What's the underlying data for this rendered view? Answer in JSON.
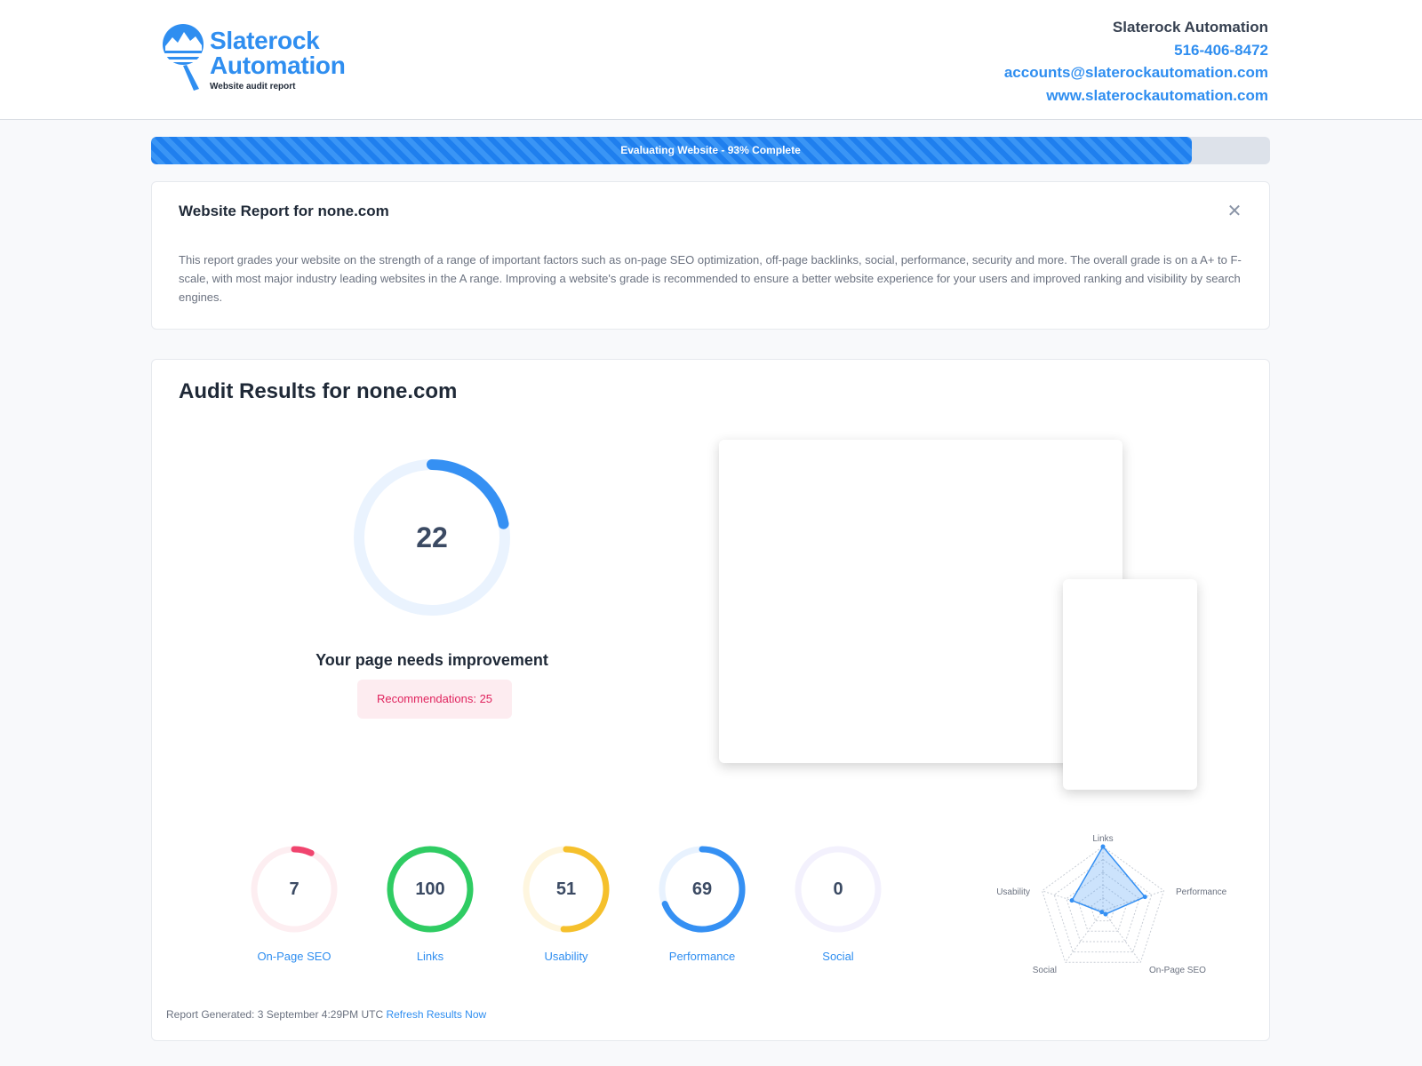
{
  "header": {
    "logo": {
      "line1": "Slaterock",
      "line2": "Automation",
      "tagline": "Website audit report"
    },
    "company": "Slaterock Automation",
    "phone": "516-406-8472",
    "email": "accounts@slaterockautomation.com",
    "website": "www.slaterockautomation.com"
  },
  "progress": {
    "label": "Evaluating Website - 93% Complete",
    "percent": 93
  },
  "intro": {
    "title": "Website Report for none.com",
    "text": "This report grades your website on the strength of a range of important factors such as on-page SEO optimization, off-page backlinks, social, performance, security and more. The overall grade is on a A+ to F-scale, with most major industry leading websites in the A range. Improving a website's grade is recommended to ensure a better website experience for your users and improved ranking and visibility by search engines."
  },
  "audit": {
    "title": "Audit Results for none.com",
    "overall_score": "22",
    "overall_value": 22,
    "verdict": "Your page needs improvement",
    "recommendations": "Recommendations: 25",
    "report_generated": "Report Generated: 3 September 4:29PM UTC",
    "refresh_label": "Refresh Results Now"
  },
  "categories": [
    {
      "label": "On-Page SEO",
      "score": "7",
      "value": 7,
      "color": "#f0446e",
      "track": "#fdeef1"
    },
    {
      "label": "Links",
      "score": "100",
      "value": 100,
      "color": "#2fcc63",
      "track": "#e6f8ec"
    },
    {
      "label": "Usability",
      "score": "51",
      "value": 51,
      "color": "#f5c02c",
      "track": "#fef6df"
    },
    {
      "label": "Performance",
      "score": "69",
      "value": 69,
      "color": "#3590f3",
      "track": "#e8f2fe"
    },
    {
      "label": "Social",
      "score": "0",
      "value": 0,
      "color": "#8b5cf6",
      "track": "#f3f1fd"
    }
  ],
  "radar": {
    "axes": [
      "Links",
      "Performance",
      "On-Page SEO",
      "Social",
      "Usability"
    ],
    "values": [
      100,
      69,
      7,
      0,
      51
    ]
  },
  "colors": {
    "accent": "#2f8ef0",
    "big_gauge": "#3590f3",
    "big_track": "#eaf3fe"
  }
}
